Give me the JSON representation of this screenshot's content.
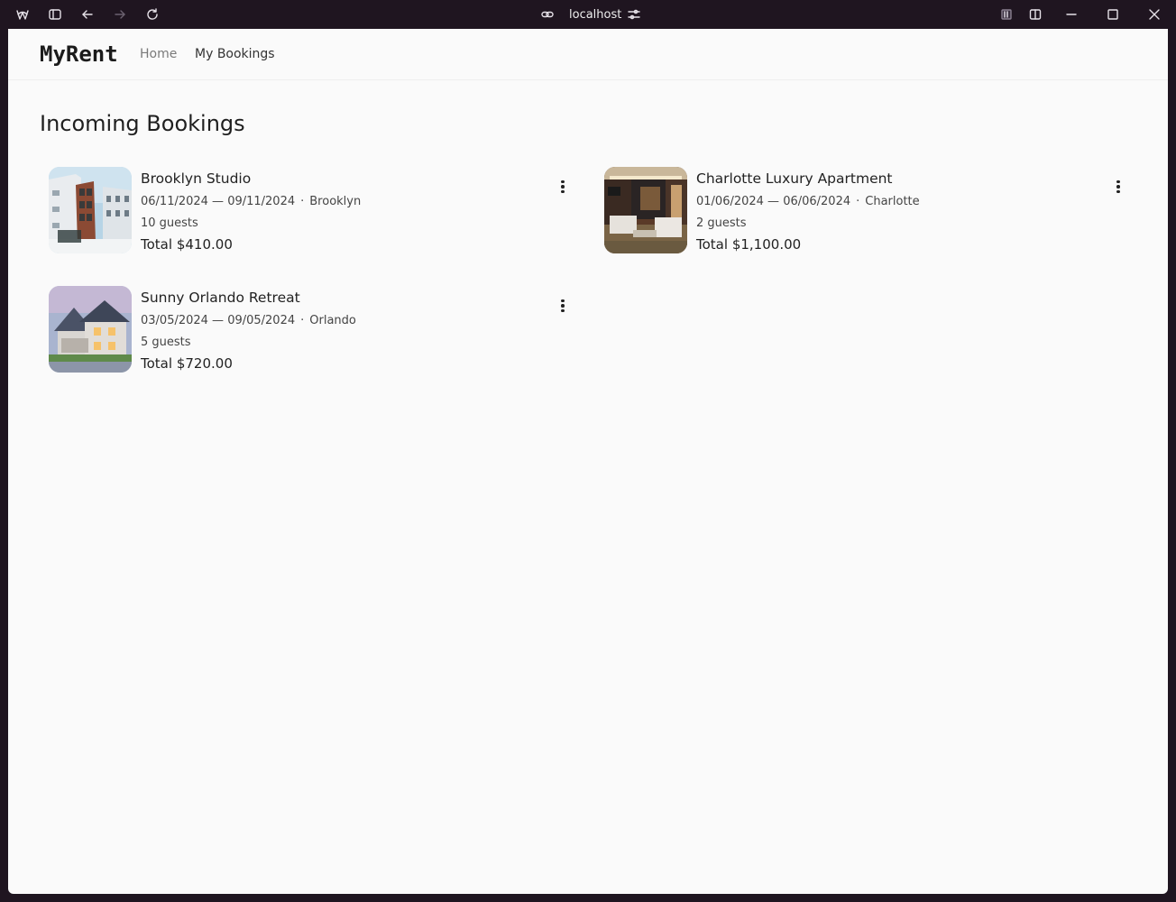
{
  "browser": {
    "url": "localhost",
    "icons": [
      "app-logo-icon",
      "sidebar-toggle-icon",
      "back-icon",
      "forward-icon",
      "reload-icon",
      "link-icon",
      "site-settings-icon",
      "extension-icon",
      "split-view-icon",
      "minimize-icon",
      "maximize-icon",
      "close-icon"
    ]
  },
  "nav": {
    "brand": "MyRent",
    "links": [
      "Home",
      "My Bookings"
    ]
  },
  "page": {
    "title": "Incoming Bookings"
  },
  "bookings": [
    {
      "title": "Brooklyn Studio",
      "dates": "06/11/2024 — 09/11/2024",
      "separator": "·",
      "location": "Brooklyn",
      "guests": "10 guests",
      "total_label": "Total",
      "total": "$410.00"
    },
    {
      "title": "Charlotte Luxury Apartment",
      "dates": "01/06/2024 — 06/06/2024",
      "separator": "·",
      "location": "Charlotte",
      "guests": "2 guests",
      "total_label": "Total",
      "total": "$1,100.00"
    },
    {
      "title": "Sunny Orlando Retreat",
      "dates": "03/05/2024 — 09/05/2024",
      "separator": "·",
      "location": "Orlando",
      "guests": "5 guests",
      "total_label": "Total",
      "total": "$720.00"
    }
  ]
}
